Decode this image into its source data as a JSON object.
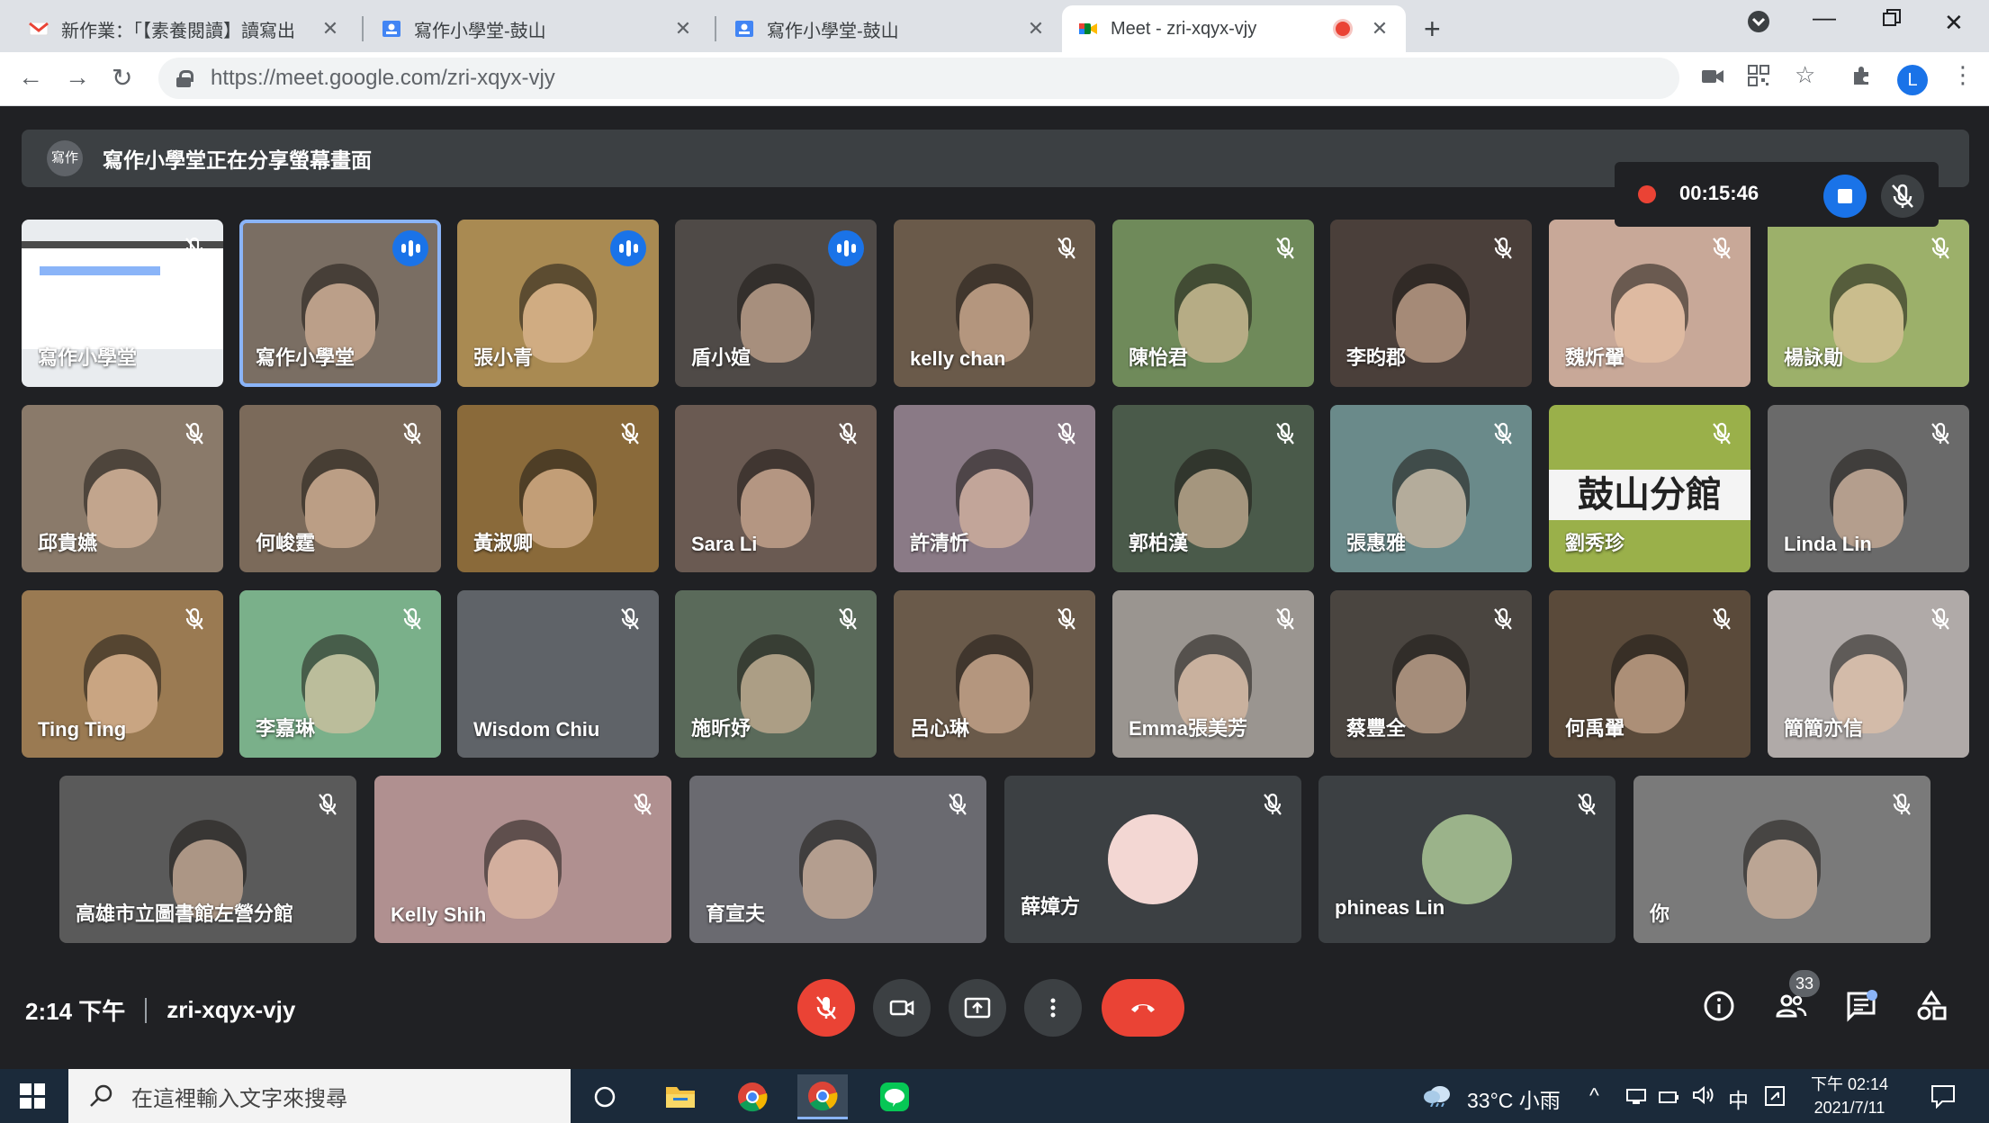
{
  "browser": {
    "tabs": [
      {
        "title": "新作業：「【素養閱讀】讀寫出",
        "icon": "gmail-icon",
        "active": false
      },
      {
        "title": "寫作小學堂-鼓山",
        "icon": "classroom-icon",
        "active": false
      },
      {
        "title": "寫作小學堂-鼓山",
        "icon": "classroom-icon",
        "active": false
      },
      {
        "title": "Meet - zri-xqyx-vjy",
        "icon": "meet-icon",
        "active": true
      }
    ],
    "new_tab": "+",
    "url": "https://meet.google.com/zri-xqyx-vjy",
    "profile_initial": "L"
  },
  "meet": {
    "presenting_banner": {
      "avatar_text": "寫作",
      "text": "寫作小學堂正在分享螢幕畫面"
    },
    "recording": {
      "time": "00:15:46"
    },
    "tiles": [
      {
        "name": "寫作小學堂",
        "state": "muted",
        "bg": "#e9ecef",
        "kind": "screen"
      },
      {
        "name": "寫作小學堂",
        "state": "speaking",
        "bg": "#7a6e63"
      },
      {
        "name": "張小青",
        "state": "speaking",
        "bg": "#a98a52"
      },
      {
        "name": "盾小媗",
        "state": "speaking",
        "bg": "#4f4a47"
      },
      {
        "name": "kelly chan",
        "state": "muted",
        "bg": "#6a5a4a"
      },
      {
        "name": "陳怡君",
        "state": "muted",
        "bg": "#6f8a5a"
      },
      {
        "name": "李昀郡",
        "state": "muted",
        "bg": "#4a3f3a"
      },
      {
        "name": "魏炘翬",
        "state": "muted",
        "bg": "#c8a898"
      },
      {
        "name": "楊詠勛",
        "state": "muted",
        "bg": "#9cb06a"
      },
      {
        "name": "邱貴嬿",
        "state": "muted",
        "bg": "#8a7a6a"
      },
      {
        "name": "何峻霆",
        "state": "muted",
        "bg": "#7b6a5a"
      },
      {
        "name": "黃淑卿",
        "state": "muted",
        "bg": "#8a6a3a"
      },
      {
        "name": "Sara Li",
        "state": "muted",
        "bg": "#6a5a52"
      },
      {
        "name": "許清忻",
        "state": "muted",
        "bg": "#8a7a86"
      },
      {
        "name": "郭柏漢",
        "state": "muted",
        "bg": "#4a5a4a"
      },
      {
        "name": "張惠雅",
        "state": "muted",
        "bg": "#6a8a8a"
      },
      {
        "name": "劉秀珍",
        "state": "muted",
        "bg": "#9ab04a",
        "kind": "sign",
        "sign_text": "鼓山分館"
      },
      {
        "name": "Linda Lin",
        "state": "muted",
        "bg": "#6a6a6a"
      },
      {
        "name": "Ting Ting",
        "state": "muted",
        "bg": "#9a7a52"
      },
      {
        "name": "李嘉琳",
        "state": "muted",
        "bg": "#7ab08a"
      },
      {
        "name": "Wisdom Chiu",
        "state": "muted",
        "bg": "#5f6368",
        "kind": "blank"
      },
      {
        "name": "施昕妤",
        "state": "muted",
        "bg": "#5a6a5a"
      },
      {
        "name": "呂心琳",
        "state": "muted",
        "bg": "#6a5a4a"
      },
      {
        "name": "Emma張美芳",
        "state": "muted",
        "bg": "#9a9590"
      },
      {
        "name": "蔡豐全",
        "state": "muted",
        "bg": "#4a4540"
      },
      {
        "name": "何禹翬",
        "state": "muted",
        "bg": "#5a4a3a"
      },
      {
        "name": "簡簡亦信",
        "state": "muted",
        "bg": "#b0aaa8"
      },
      {
        "name": "高雄市立圖書館左營分館",
        "state": "muted",
        "bg": "#5a5a5a"
      },
      {
        "name": "Kelly Shih",
        "state": "muted",
        "bg": "#b09090"
      },
      {
        "name": "育宣夫",
        "state": "muted",
        "bg": "#6a6a70"
      },
      {
        "name": "薛嫜方",
        "state": "muted",
        "bg": "#3c4043",
        "kind": "avatar",
        "avatar_color": "#f3d7d3"
      },
      {
        "name": "phineas Lin",
        "state": "muted",
        "bg": "#3c4043",
        "kind": "avatar",
        "avatar_color": "#9bb38a"
      },
      {
        "name": "你",
        "state": "muted",
        "bg": "#7a7a7a"
      }
    ],
    "bottom_bar": {
      "time": "2:14 下午",
      "meeting_code": "zri-xqyx-vjy",
      "participant_count": "33"
    }
  },
  "taskbar": {
    "search_placeholder": "在這裡輸入文字來搜尋",
    "weather": "33°C 小雨",
    "ime": "中",
    "clock_time": "下午 02:14",
    "clock_date": "2021/7/11"
  },
  "colors": {
    "meet_bg": "#202124",
    "tile_bg": "#3c4043",
    "accent_blue": "#1a73e8",
    "danger_red": "#ea4335"
  }
}
